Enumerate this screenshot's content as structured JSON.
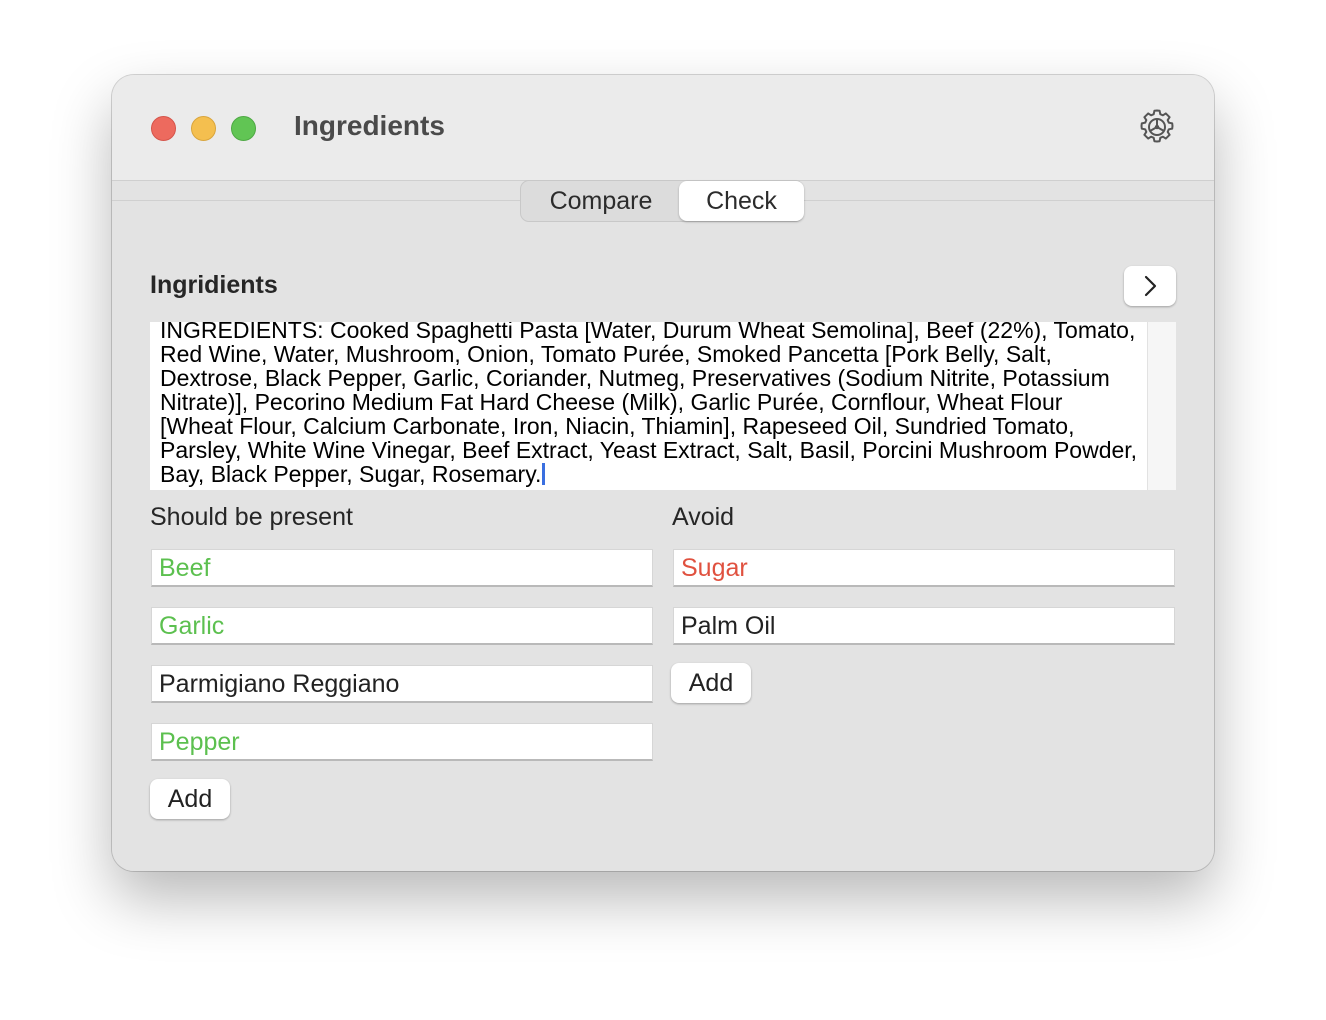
{
  "window": {
    "title": "Ingredients"
  },
  "tabs": [
    {
      "label": "Compare",
      "selected": false
    },
    {
      "label": "Check",
      "selected": true
    }
  ],
  "ingredients": {
    "heading": "Ingridients",
    "text": "INGREDIENTS: Cooked Spaghetti Pasta [Water, Durum Wheat Semolina], Beef (22%), Tomato, Red Wine, Water, Mushroom, Onion, Tomato Purée, Smoked Pancetta [Pork Belly, Salt, Dextrose, Black Pepper, Garlic, Coriander, Nutmeg, Preservatives (Sodium Nitrite, Potassium Nitrate)], Pecorino Medium Fat Hard Cheese (Milk), Garlic Purée, Cornflour, Wheat Flour [Wheat Flour, Calcium Carbonate, Iron, Niacin, Thiamin], Rapeseed Oil, Sundried Tomato, Parsley, White Wine Vinegar, Beef Extract, Yeast Extract, Salt, Basil, Porcini Mushroom Powder, Bay, Black Pepper, Sugar, Rosemary."
  },
  "should_be_present": {
    "label": "Should be present",
    "items": [
      {
        "value": "Beef",
        "color": "#5cc04f"
      },
      {
        "value": "Garlic",
        "color": "#5cc04f"
      },
      {
        "value": "Parmigiano Reggiano",
        "color": "#222222"
      },
      {
        "value": "Pepper",
        "color": "#5cc04f"
      }
    ],
    "add_label": "Add"
  },
  "avoid": {
    "label": "Avoid",
    "items": [
      {
        "value": "Sugar",
        "color": "#e0513f"
      },
      {
        "value": "Palm Oil",
        "color": "#222222"
      }
    ],
    "add_label": "Add"
  },
  "icons": {
    "settings": "gear-icon",
    "next": "chevron-right-icon"
  }
}
